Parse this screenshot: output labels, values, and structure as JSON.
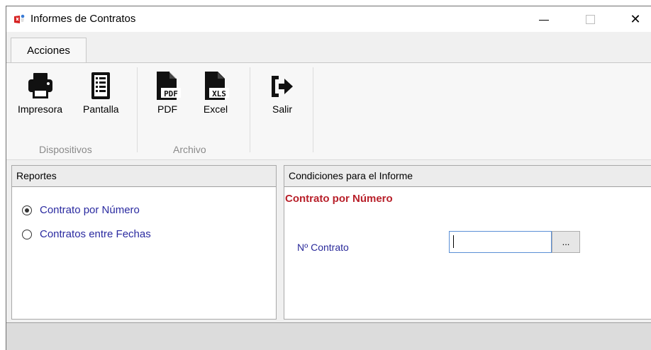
{
  "window": {
    "title": "Informes de Contratos",
    "minimize_icon": "minimize-icon",
    "maximize_icon": "maximize-icon",
    "close_icon": "close-icon",
    "close_glyph": "✕"
  },
  "ribbon": {
    "tab_label": "Acciones",
    "groups": {
      "dispositivos": "Dispositivos",
      "archivo": "Archivo"
    },
    "buttons": {
      "impresora": {
        "label": "Impresora",
        "icon": "printer-icon"
      },
      "pantalla": {
        "label": "Pantalla",
        "icon": "screen-list-icon"
      },
      "pdf": {
        "label": "PDF",
        "icon": "pdf-file-icon",
        "badge": "PDF"
      },
      "excel": {
        "label": "Excel",
        "icon": "xls-file-icon",
        "badge": "XLS"
      },
      "salir": {
        "label": "Salir",
        "icon": "exit-icon"
      }
    }
  },
  "reportes": {
    "header": "Reportes",
    "options": [
      {
        "label": "Contrato por Número",
        "selected": true
      },
      {
        "label": "Contratos entre Fechas",
        "selected": false
      }
    ]
  },
  "condiciones": {
    "header": "Condiciones para el Informe",
    "title": "Contrato por Número",
    "field_label": "Nº Contrato",
    "field_value": "",
    "lookup_button": "..."
  },
  "colors": {
    "accent_red": "#b8202a",
    "label_blue": "#2a2aa0",
    "input_border": "#5a8fd6"
  }
}
